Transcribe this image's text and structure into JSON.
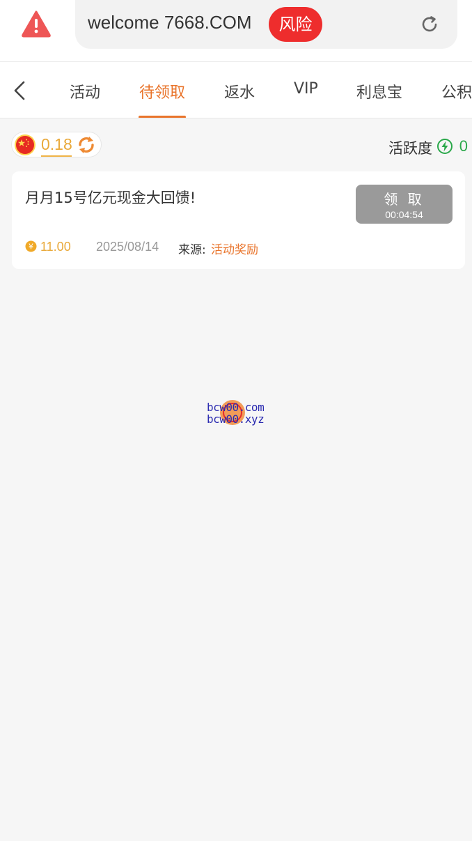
{
  "browser": {
    "url": "welcome 7668.COM",
    "risk_label": "风险",
    "icons": {
      "warning": "warning-triangle-icon",
      "reload": "reload-icon"
    }
  },
  "tabs": {
    "items": [
      {
        "label": "活动"
      },
      {
        "label": "待领取"
      },
      {
        "label": "返水"
      },
      {
        "label": "VIP"
      },
      {
        "label": "利息宝"
      },
      {
        "label": "公积"
      }
    ],
    "active_index": 1
  },
  "wallet": {
    "balance": "0.18",
    "activity_label": "活跃度",
    "activity_value": "0"
  },
  "rewards": [
    {
      "title": "月月15号亿元现金大回馈!",
      "claim_label": "领 取",
      "countdown": "00:04:54",
      "amount": "11.00",
      "date": "2025/08/14",
      "source_label": "来源:",
      "source_value": "活动奖励"
    }
  ],
  "watermark": {
    "line1": "bcw00.com",
    "line2": "bcw00.xyz"
  },
  "colors": {
    "accent": "#e9742b",
    "gold": "#e9a93a",
    "risk": "#ee2d2d",
    "activity": "#2aa84a",
    "disabled": "#9a9a9a"
  }
}
